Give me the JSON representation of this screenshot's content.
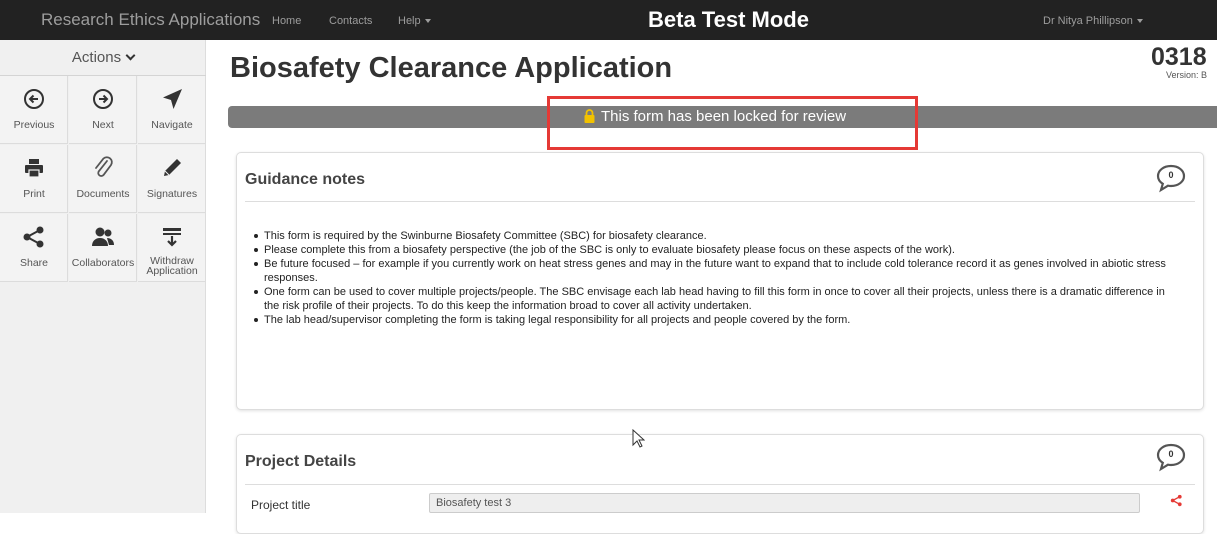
{
  "navbar": {
    "brand": "Research Ethics Applications",
    "links": [
      "Home",
      "Contacts",
      "Help"
    ],
    "mode_banner": "Beta Test Mode",
    "user": "Dr Nitya Phillipson"
  },
  "sidebar": {
    "actions_label": "Actions",
    "items": [
      {
        "label": "Previous",
        "icon": "arrow-left-circle-icon"
      },
      {
        "label": "Next",
        "icon": "arrow-right-circle-icon"
      },
      {
        "label": "Navigate",
        "icon": "location-arrow-icon"
      },
      {
        "label": "Print",
        "icon": "printer-icon"
      },
      {
        "label": "Documents",
        "icon": "paperclip-icon"
      },
      {
        "label": "Signatures",
        "icon": "pencil-icon"
      },
      {
        "label": "Share",
        "icon": "share-icon"
      },
      {
        "label": "Collaborators",
        "icon": "users-icon"
      },
      {
        "label": "Withdraw Application",
        "icon": "withdraw-icon"
      }
    ]
  },
  "page": {
    "title": "Biosafety Clearance Application",
    "application_number": "0318",
    "version": "Version: B",
    "lock_message": "This form has been locked for review",
    "highlight_color": "#e53935"
  },
  "guidance": {
    "heading": "Guidance notes",
    "comment_count": "0",
    "notes": [
      "This form is required by the Swinburne Biosafety Committee (SBC) for biosafety clearance.",
      "Please complete this from a biosafety perspective (the job of the SBC is only to evaluate biosafety please focus on these aspects of the work).",
      "Be future focused – for example if you currently work on heat stress genes and may in the future want to expand that to include cold tolerance record it as genes involved in abiotic stress responses.",
      "One form can be used to cover multiple projects/people. The SBC envisage each lab head having to fill this form in once to cover all their projects, unless there is a dramatic difference in the risk profile of their projects. To do this keep the information broad to cover all activity undertaken.",
      "The lab head/supervisor completing the form is taking legal responsibility for all projects and people covered by the form."
    ]
  },
  "project": {
    "heading": "Project Details",
    "comment_count": "0",
    "title_label": "Project title",
    "title_value": "Biosafety test 3",
    "share_color": "#e53935"
  }
}
